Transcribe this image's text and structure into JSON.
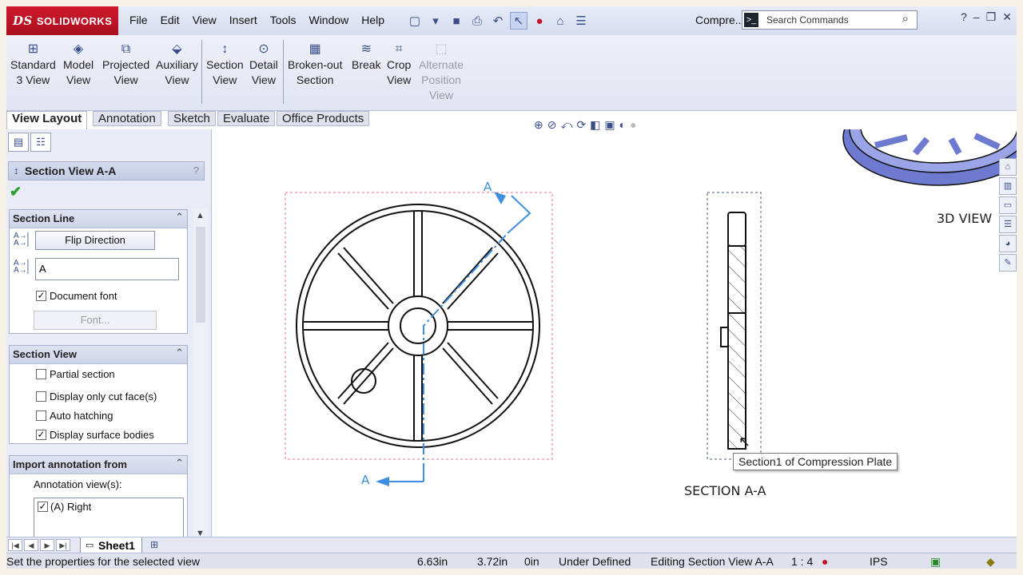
{
  "app": {
    "logo": "SOLIDWORKS",
    "logo_mark": "DS",
    "doc_name": "Compre..."
  },
  "menu": [
    "File",
    "Edit",
    "View",
    "Insert",
    "Tools",
    "Window",
    "Help"
  ],
  "search": {
    "placeholder": "Search Commands"
  },
  "commands": [
    {
      "line1": "Standard",
      "line2": "3 View",
      "icon": "standard-3-view-icon"
    },
    {
      "line1": "Model",
      "line2": "View",
      "icon": "model-view-icon"
    },
    {
      "line1": "Projected",
      "line2": "View",
      "icon": "projected-view-icon"
    },
    {
      "line1": "Auxiliary",
      "line2": "View",
      "icon": "auxiliary-view-icon"
    },
    {
      "line1": "Section",
      "line2": "View",
      "icon": "section-view-icon"
    },
    {
      "line1": "Detail",
      "line2": "View",
      "icon": "detail-view-icon"
    },
    {
      "line1": "Broken-out",
      "line2": "Section",
      "icon": "broken-out-section-icon"
    },
    {
      "line1": "Break",
      "line2": "",
      "icon": "break-icon"
    },
    {
      "line1": "Crop",
      "line2": "View",
      "icon": "crop-view-icon"
    },
    {
      "line1": "Alternate",
      "line2": "Position",
      "line3": "View",
      "icon": "alternate-position-view-icon"
    }
  ],
  "tabs": [
    "View Layout",
    "Annotation",
    "Sketch",
    "Evaluate",
    "Office Products"
  ],
  "property_manager": {
    "title": "Section View A-A",
    "help": "?",
    "section_line": {
      "header": "Section Line",
      "flip_direction": "Flip Direction",
      "label_value": "A",
      "document_font_label": "Document font",
      "document_font_checked": true,
      "font_button": "Font..."
    },
    "section_view": {
      "header": "Section View",
      "options": [
        {
          "label": "Partial section",
          "checked": false
        },
        {
          "label": "Display only cut face(s)",
          "checked": false
        },
        {
          "label": "Auto hatching",
          "checked": false
        },
        {
          "label": "Display surface bodies",
          "checked": true
        }
      ]
    },
    "import_annotation": {
      "header": "Import annotation from",
      "annotation_views_label": "Annotation view(s):",
      "views": [
        {
          "label": "(A) Right",
          "checked": true
        }
      ]
    }
  },
  "sheet": {
    "name": "Sheet1"
  },
  "drawing": {
    "section_label_top": "A",
    "section_label_bottom": "A",
    "section_view_label": "SECTION A-A",
    "view_3d_label": "3D VIEW",
    "tooltip": "Section1 of Compression Plate"
  },
  "status": {
    "message": "Set the properties for the selected view",
    "x": "6.63in",
    "y": "3.72in",
    "z": "0in",
    "state": "Under Defined",
    "editing": "Editing Section View A-A",
    "scale": "1 : 4",
    "units": "IPS"
  },
  "colors": {
    "section_line": "#3f8fe0",
    "bounding_box": "#e86d93",
    "logo_red": "#c0142a"
  }
}
